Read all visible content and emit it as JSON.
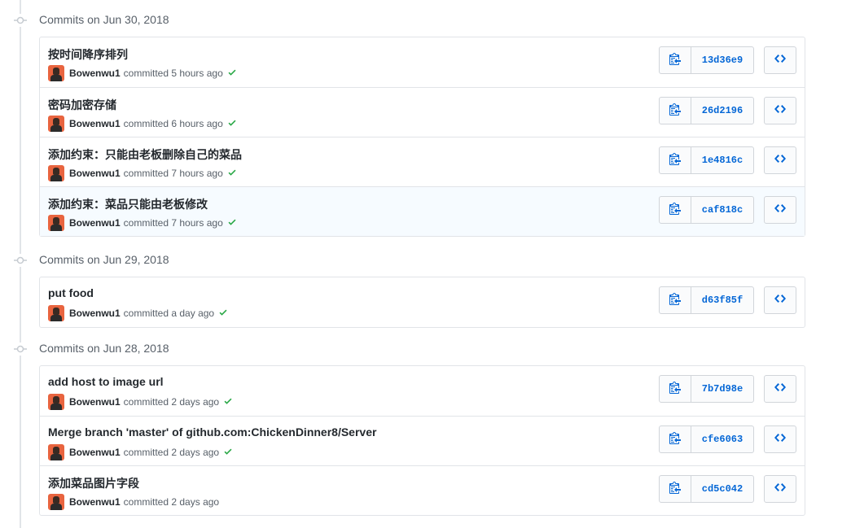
{
  "groups": [
    {
      "date": "Commits on Jun 30, 2018",
      "commits": [
        {
          "message": "按时间降序排列",
          "author": "Bowenwu1",
          "action": "committed",
          "time": "5 hours ago",
          "verified": true,
          "sha": "13d36e9"
        },
        {
          "message": "密码加密存储",
          "author": "Bowenwu1",
          "action": "committed",
          "time": "6 hours ago",
          "verified": true,
          "sha": "26d2196"
        },
        {
          "message": "添加约束：只能由老板删除自己的菜品",
          "author": "Bowenwu1",
          "action": "committed",
          "time": "7 hours ago",
          "verified": true,
          "sha": "1e4816c"
        },
        {
          "message": "添加约束：菜品只能由老板修改",
          "author": "Bowenwu1",
          "action": "committed",
          "time": "7 hours ago",
          "verified": true,
          "sha": "caf818c",
          "hovered": true
        }
      ]
    },
    {
      "date": "Commits on Jun 29, 2018",
      "commits": [
        {
          "message": "put food",
          "author": "Bowenwu1",
          "action": "committed",
          "time": "a day ago",
          "verified": true,
          "sha": "d63f85f"
        }
      ]
    },
    {
      "date": "Commits on Jun 28, 2018",
      "commits": [
        {
          "message": "add host to image url",
          "author": "Bowenwu1",
          "action": "committed",
          "time": "2 days ago",
          "verified": true,
          "sha": "7b7d98e"
        },
        {
          "message": "Merge branch 'master' of github.com:ChickenDinner8/Server",
          "author": "Bowenwu1",
          "action": "committed",
          "time": "2 days ago",
          "verified": true,
          "sha": "cfe6063"
        },
        {
          "message": "添加菜品图片字段",
          "author": "Bowenwu1",
          "action": "committed",
          "time": "2 days ago",
          "verified": false,
          "sha": "cd5c042"
        }
      ]
    }
  ],
  "icons": {
    "timeline_node": "git-commit-icon",
    "copy": "clippy-icon",
    "browse": "code-icon",
    "status": "check-icon"
  },
  "colors": {
    "sha_link": "#0366d6",
    "check": "#28a745",
    "hover_row": "#f6fbff",
    "avatar_bg": "#e8643f"
  }
}
